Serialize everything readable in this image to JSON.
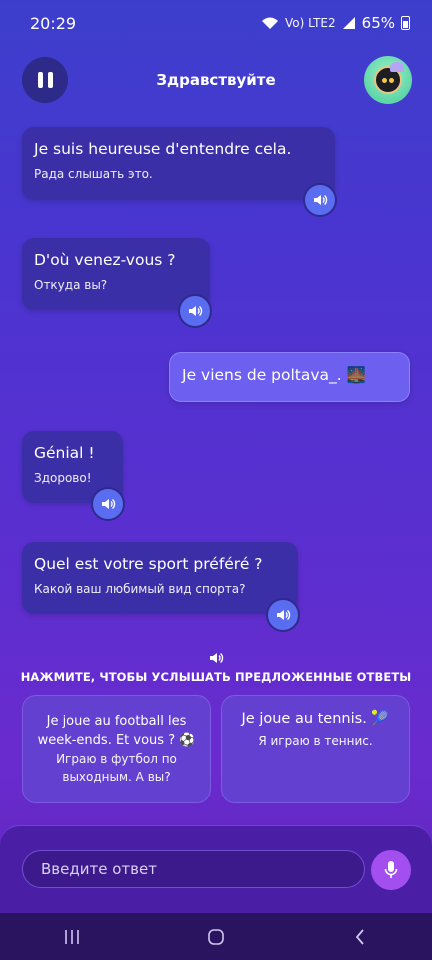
{
  "status": {
    "time": "20:29",
    "battery": "65%",
    "signal_label": "Vo) LTE2"
  },
  "header": {
    "title": "Здравствуйте"
  },
  "messages": [
    {
      "fr": "Je suis heureuse d'entendre cela.",
      "ru": "Рада слышать это."
    },
    {
      "fr": "D'où venez-vous ?",
      "ru": "Откуда вы?"
    },
    {
      "fr": "Je viens de poltava_. 🌉"
    },
    {
      "fr": "Génial !",
      "ru": "Здорово!"
    },
    {
      "fr": "Quel est votre sport préféré ?",
      "ru": "Какой ваш любимый вид спорта?"
    }
  ],
  "hint": {
    "text": "НАЖМИТЕ, ЧТОБЫ УСЛЫШАТЬ ПРЕДЛОЖЕННЫЕ ОТВЕТЫ"
  },
  "suggestions": [
    {
      "fr": "Je joue au football les week-ends. Et vous ? ⚽",
      "ru": "Играю в футбол по выходным. А вы?"
    },
    {
      "fr": "Je joue au tennis. 🎾",
      "ru": "Я играю в теннис."
    }
  ],
  "input": {
    "placeholder": "Введите ответ"
  },
  "colors": {
    "bot_bubble": "#3b2fa8",
    "user_bubble": "#6d5ff0",
    "mic": "#a34ff0"
  }
}
